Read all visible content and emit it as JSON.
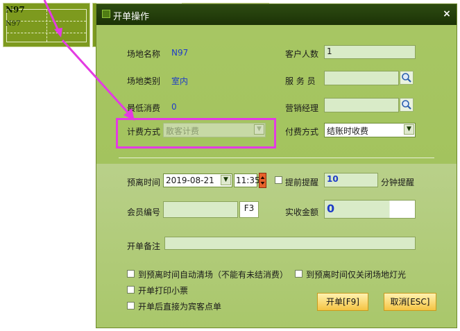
{
  "background": {
    "tile_title": "N97",
    "tile_sub": "N97"
  },
  "dialog": {
    "title": "开单操作",
    "close_glyph": "×",
    "fields": {
      "venue_name_label": "场地名称",
      "venue_name_value": "N97",
      "venue_type_label": "场地类别",
      "venue_type_value": "室内",
      "min_spend_label": "最低消费",
      "min_spend_value": "0",
      "billing_method_label": "计费方式",
      "billing_method_value": "散客计费",
      "customer_count_label": "客户人数",
      "customer_count_value": "1",
      "server_label": "服 务 员",
      "server_value": "",
      "sales_manager_label": "营销经理",
      "sales_manager_value": "",
      "payment_method_label": "付费方式",
      "payment_method_value": "结账时收费",
      "leave_time_label": "预离时间",
      "leave_date_value": "2019-08-21",
      "leave_clock_value": "11:35",
      "early_remind_label": "提前提醒",
      "remind_minutes_value": "10",
      "remind_suffix": "分钟提醒",
      "member_no_label": "会员编号",
      "member_no_value": "",
      "member_key_hint": "F3",
      "paid_amount_label": "实收金额",
      "paid_amount_value": "0",
      "note_label": "开单备注",
      "note_value": ""
    },
    "options": {
      "auto_clear": "到预离时间自动清场（不能有未结消费）",
      "lights_only": "到预离时间仅关闭场地灯光",
      "print_receipt": "开单打印小票",
      "order_after_open": "开单后直接为宾客点单"
    },
    "buttons": {
      "open": "开单[F9]",
      "cancel": "取消[ESC]"
    }
  },
  "colors": {
    "accent_highlight": "#e33be2",
    "dialog_green": "#a8c764",
    "titlebar": "#1c3306",
    "value_blue": "#1e3cc8"
  }
}
